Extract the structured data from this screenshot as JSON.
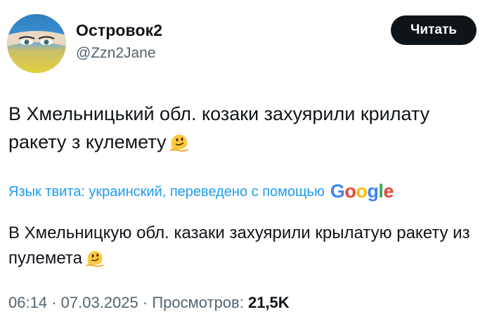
{
  "author": {
    "display_name": "Островок2",
    "handle": "@Zzn2Jane"
  },
  "actions": {
    "read_label": "Читать"
  },
  "tweet": {
    "text": "В Хмельницький обл. козаки захуярили крилату ракету з кулемету",
    "emoji": "melting-face-emoji"
  },
  "translation": {
    "notice": "Язык твита: украинский, переведено с помощью",
    "provider": "Google",
    "text": "В Хмельницкую обл. казаки захуярили крылатую ракету из пулемета"
  },
  "meta": {
    "time": "06:14",
    "separator": "·",
    "date": "07.03.2025",
    "views_label": "Просмотров:",
    "views_count": "21,5K"
  },
  "colors": {
    "link": "#1d9bf0",
    "secondary_text": "#536471",
    "primary_text": "#0f1419",
    "button_bg": "#0f1419"
  }
}
